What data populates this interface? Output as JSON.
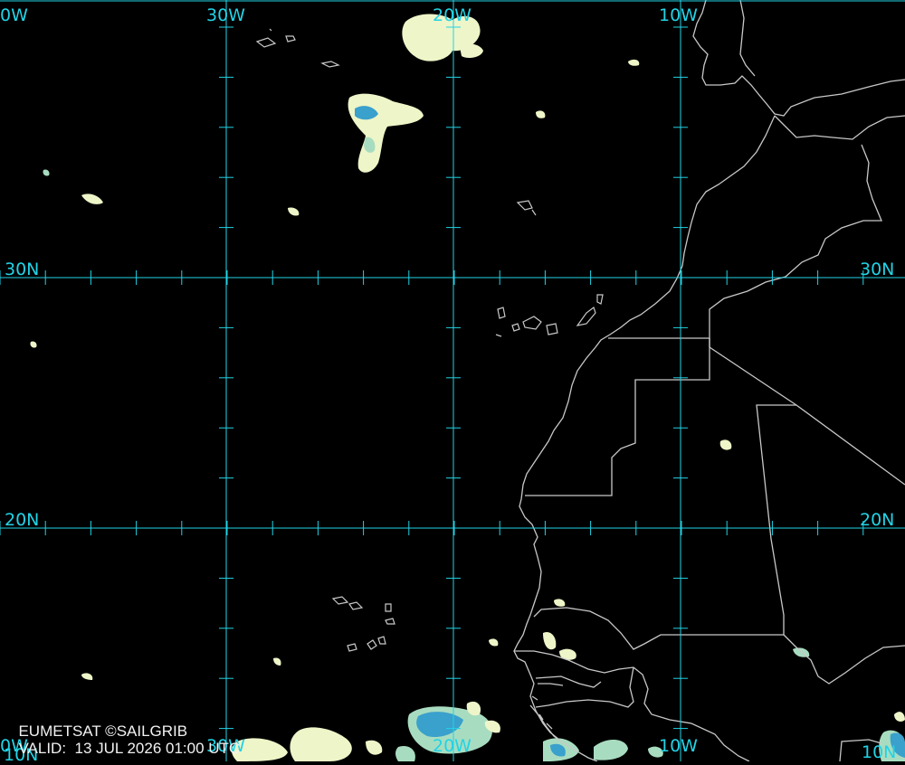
{
  "credit": {
    "line1": "EUMETSAT ©SAILGRIB",
    "valid_label": "VALID:",
    "valid_time": "13 JUL 2026 01:00 UTC"
  },
  "graticule": {
    "lon_top": [
      "0W",
      "30W",
      "20W",
      "10W"
    ],
    "lon_bottom": [
      "0W",
      "30W",
      "20W",
      "10W",
      "10N"
    ],
    "lat_left": [
      "30N",
      "20N",
      "10N"
    ],
    "lat_right": [
      "30N",
      "20N"
    ]
  },
  "colors": {
    "background": "#000000",
    "grid": "#22d3e6",
    "coastline": "#c8c8c8",
    "cloud_light": "#eef5c8",
    "cloud_mid": "#a8dcc0",
    "cloud_deep": "#3aa0cc"
  }
}
